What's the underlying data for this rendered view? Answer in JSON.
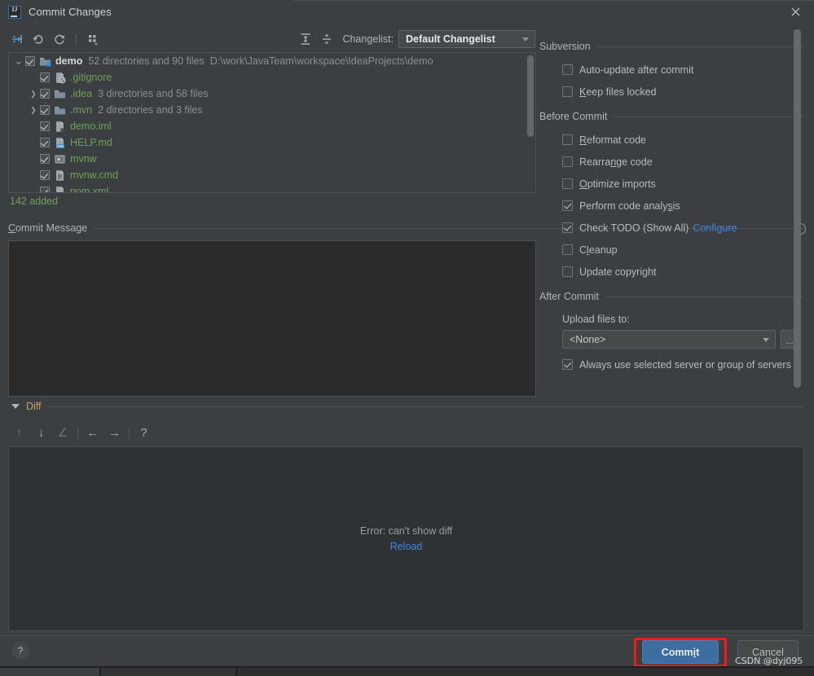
{
  "window": {
    "title": "Commit Changes",
    "logo_icon": "intellij-idea-logo-icon",
    "close_icon": "close-icon"
  },
  "toolbar": {
    "icons": [
      {
        "name": "move-to-changelist-icon",
        "glyph": "move"
      },
      {
        "name": "rollback-icon",
        "glyph": "undo"
      },
      {
        "name": "refresh-icon",
        "glyph": "refresh"
      },
      {
        "name": "group-by-icon",
        "glyph": "group"
      }
    ],
    "right_icons": [
      {
        "name": "expand-all-icon",
        "glyph": "expand"
      },
      {
        "name": "collapse-all-icon",
        "glyph": "collapse"
      }
    ],
    "changelist_label": "Changelist:",
    "changelist_value": "Default Changelist"
  },
  "tree": {
    "rows": [
      {
        "twisty": "v",
        "indent": 0,
        "checked": true,
        "icon": "folder-module-icon",
        "name": "demo",
        "name_style": "white",
        "meta": "52 directories and 90 files",
        "path": "D:\\work\\JavaTeam\\workspace\\IdeaProjects\\demo"
      },
      {
        "twisty": "",
        "indent": 1,
        "checked": true,
        "icon": "gitignore-file-icon",
        "name": ".gitignore",
        "name_style": "green",
        "meta": "",
        "path": ""
      },
      {
        "twisty": ">",
        "indent": 1,
        "checked": true,
        "icon": "folder-icon",
        "name": ".idea",
        "name_style": "green",
        "meta": "3 directories and 58 files",
        "path": ""
      },
      {
        "twisty": ">",
        "indent": 1,
        "checked": true,
        "icon": "folder-icon",
        "name": ".mvn",
        "name_style": "green",
        "meta": "2 directories and 3 files",
        "path": ""
      },
      {
        "twisty": "",
        "indent": 1,
        "checked": true,
        "icon": "iml-file-icon",
        "name": "demo.iml",
        "name_style": "green",
        "meta": "",
        "path": ""
      },
      {
        "twisty": "",
        "indent": 1,
        "checked": true,
        "icon": "markdown-file-icon",
        "name": "HELP.md",
        "name_style": "green",
        "meta": "",
        "path": ""
      },
      {
        "twisty": "",
        "indent": 1,
        "checked": true,
        "icon": "shell-script-icon",
        "name": "mvnw",
        "name_style": "green",
        "meta": "",
        "path": ""
      },
      {
        "twisty": "",
        "indent": 1,
        "checked": true,
        "icon": "cmd-file-icon",
        "name": "mvnw.cmd",
        "name_style": "green",
        "meta": "",
        "path": ""
      },
      {
        "twisty": "",
        "indent": 1,
        "checked": true,
        "icon": "xml-file-icon",
        "name": "pom.xml",
        "name_style": "green",
        "meta": "",
        "path": ""
      }
    ],
    "added_count": "142 added"
  },
  "commit_message": {
    "section_label": "Commit Message",
    "value": "",
    "history_icon": "clock-history-icon"
  },
  "diff": {
    "section_label": "Diff",
    "caret_icon": "chevron-down-icon",
    "toolbar_icons": [
      {
        "name": "next-difference-icon",
        "glyph": "↑"
      },
      {
        "name": "previous-difference-icon",
        "glyph": "↓"
      },
      {
        "name": "apply-difference-icon",
        "glyph": "∠"
      },
      {
        "name": "accept-left-icon",
        "glyph": "←"
      },
      {
        "name": "accept-right-icon",
        "glyph": "→"
      },
      {
        "name": "help-icon",
        "glyph": "?"
      }
    ],
    "error_text": "Error: can't show diff",
    "reload_label": "Reload"
  },
  "right_panel": {
    "sections": [
      {
        "title": "Subversion",
        "options": [
          {
            "label": "Auto-update after commit",
            "checked": false,
            "mnemonic": ""
          },
          {
            "label": "Keep files locked",
            "checked": false,
            "mnemonic": "K"
          }
        ]
      },
      {
        "title": "Before Commit",
        "options": [
          {
            "label": "Reformat code",
            "checked": false,
            "mnemonic": "R"
          },
          {
            "label": "Rearrange code",
            "checked": false,
            "mnemonic": "n"
          },
          {
            "label": "Optimize imports",
            "checked": false,
            "mnemonic": "O"
          },
          {
            "label": "Perform code analysis",
            "checked": true,
            "mnemonic": "s"
          },
          {
            "label": "Check TODO (Show All)",
            "checked": true,
            "mnemonic": "",
            "link": "Configure"
          },
          {
            "label": "Cleanup",
            "checked": false,
            "mnemonic": "l"
          },
          {
            "label": "Update copyright",
            "checked": false,
            "mnemonic": ""
          }
        ]
      },
      {
        "title": "After Commit",
        "upload_label": "Upload files to:",
        "upload_value": "<None>",
        "dots_label": "...",
        "always_use": {
          "label": "Always use selected server or group of servers",
          "checked": true
        }
      }
    ]
  },
  "footer": {
    "help_label": "?",
    "commit_label": "Commit",
    "cancel_label": "Cancel",
    "highlight_color": "#ee1c1c",
    "commit_color": "#3c6ea0",
    "watermark": "CSDN @dyj095"
  }
}
